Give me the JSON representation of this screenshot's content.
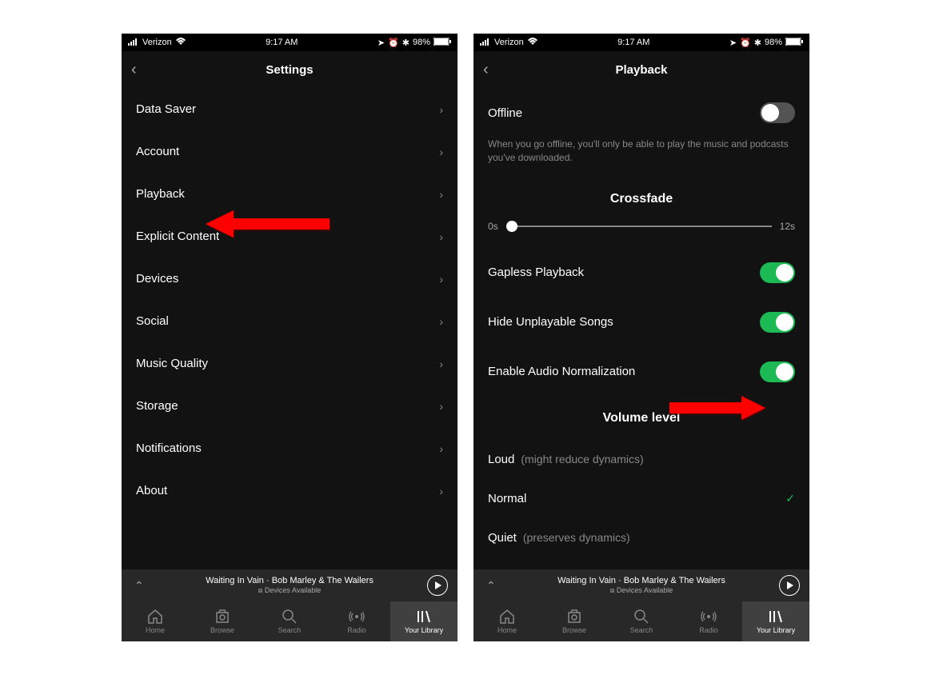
{
  "status": {
    "carrier": "Verizon",
    "time": "9:17 AM",
    "battery": "98%"
  },
  "screen1": {
    "title": "Settings",
    "items": [
      {
        "label": "Data Saver"
      },
      {
        "label": "Account"
      },
      {
        "label": "Playback"
      },
      {
        "label": "Explicit Content"
      },
      {
        "label": "Devices"
      },
      {
        "label": "Social"
      },
      {
        "label": "Music Quality"
      },
      {
        "label": "Storage"
      },
      {
        "label": "Notifications"
      },
      {
        "label": "About"
      }
    ]
  },
  "screen2": {
    "title": "Playback",
    "offline": {
      "label": "Offline",
      "description": "When you go offline, you'll only be able to play the music and podcasts you've downloaded."
    },
    "crossfade": {
      "title": "Crossfade",
      "min": "0s",
      "max": "12s"
    },
    "toggles": {
      "gapless": "Gapless Playback",
      "hide_unplayable": "Hide Unplayable Songs",
      "normalization": "Enable Audio Normalization"
    },
    "volume": {
      "title": "Volume level",
      "loud": {
        "label": "Loud",
        "hint": "(might reduce dynamics)"
      },
      "normal": {
        "label": "Normal"
      },
      "quiet": {
        "label": "Quiet",
        "hint": "(preserves dynamics)"
      }
    }
  },
  "now_playing": {
    "song": "Waiting In Vain",
    "artist": "Bob Marley & The Wailers",
    "devices": "Devices Available"
  },
  "tabs": [
    {
      "label": "Home"
    },
    {
      "label": "Browse"
    },
    {
      "label": "Search"
    },
    {
      "label": "Radio"
    },
    {
      "label": "Your Library"
    }
  ]
}
